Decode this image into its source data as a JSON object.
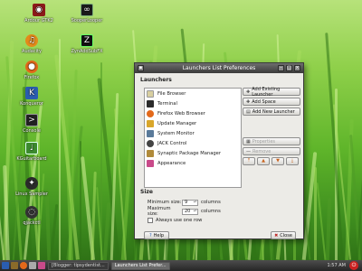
{
  "desktop": {
    "icons": [
      {
        "label": "Ardour GTK2",
        "icon": "ardour-icon",
        "color": "#8b1a1a"
      },
      {
        "label": "Audacity",
        "icon": "audacity-icon",
        "color": "#e38a1a"
      },
      {
        "label": "Firefox",
        "icon": "firefox-icon",
        "color": "#e3691a"
      },
      {
        "label": "Konqueror",
        "icon": "konqueror-icon",
        "color": "#2a5db0"
      },
      {
        "label": "Console",
        "icon": "console-icon",
        "color": "#222222"
      },
      {
        "label": "KGuitarboard",
        "icon": "guitar-icon",
        "color": "#3c8a2e"
      },
      {
        "label": "Linux Sampler",
        "icon": "linux-icon",
        "color": "#2a2a2a"
      },
      {
        "label": "qjackctl",
        "icon": "jack-icon",
        "color": "#333333"
      },
      {
        "label": "SooperLooper",
        "icon": "sooperlooper-icon",
        "color": "#1a1a1a"
      },
      {
        "label": "ZynAddSubFX",
        "icon": "zynaddsubfx-icon",
        "color": "#111111"
      }
    ]
  },
  "dialog": {
    "title": "Launchers List Preferences",
    "launchers_heading": "Launchers",
    "launchers": [
      {
        "label": "File Browser",
        "icon": "file-browser-icon",
        "color": "#d8cfa0"
      },
      {
        "label": "Terminal",
        "icon": "terminal-icon",
        "color": "#2b2b2b"
      },
      {
        "label": "Firefox Web Browser",
        "icon": "firefox-icon",
        "color": "#e3691a"
      },
      {
        "label": "Update Manager",
        "icon": "update-icon",
        "color": "#d9a62a"
      },
      {
        "label": "System Monitor",
        "icon": "monitor-icon",
        "color": "#5a7a9a"
      },
      {
        "label": "JACK Control",
        "icon": "jack-icon",
        "color": "#444444"
      },
      {
        "label": "Synaptic Package Manager",
        "icon": "package-icon",
        "color": "#b08a3a"
      },
      {
        "label": "Appearance",
        "icon": "appearance-icon",
        "color": "#c94a8a"
      }
    ],
    "buttons": {
      "add_existing": "Add Existing Launcher",
      "add_space": "Add Space",
      "add_new": "Add New Launcher",
      "properties": "Properties",
      "remove": "Remove"
    },
    "size_heading": "Size",
    "minimum_label": "Minimum size:",
    "minimum_value": "9",
    "maximum_label": "Maximum size:",
    "maximum_value": "20",
    "unit": "columns",
    "one_row_label": "Always use one row",
    "help": "Help",
    "close": "Close"
  },
  "taskbar": {
    "tasks": [
      {
        "label": "[Blogger: tipsydentist..."
      },
      {
        "label": "Launchers List Prefer..."
      }
    ],
    "clock": "1:57 AM"
  }
}
